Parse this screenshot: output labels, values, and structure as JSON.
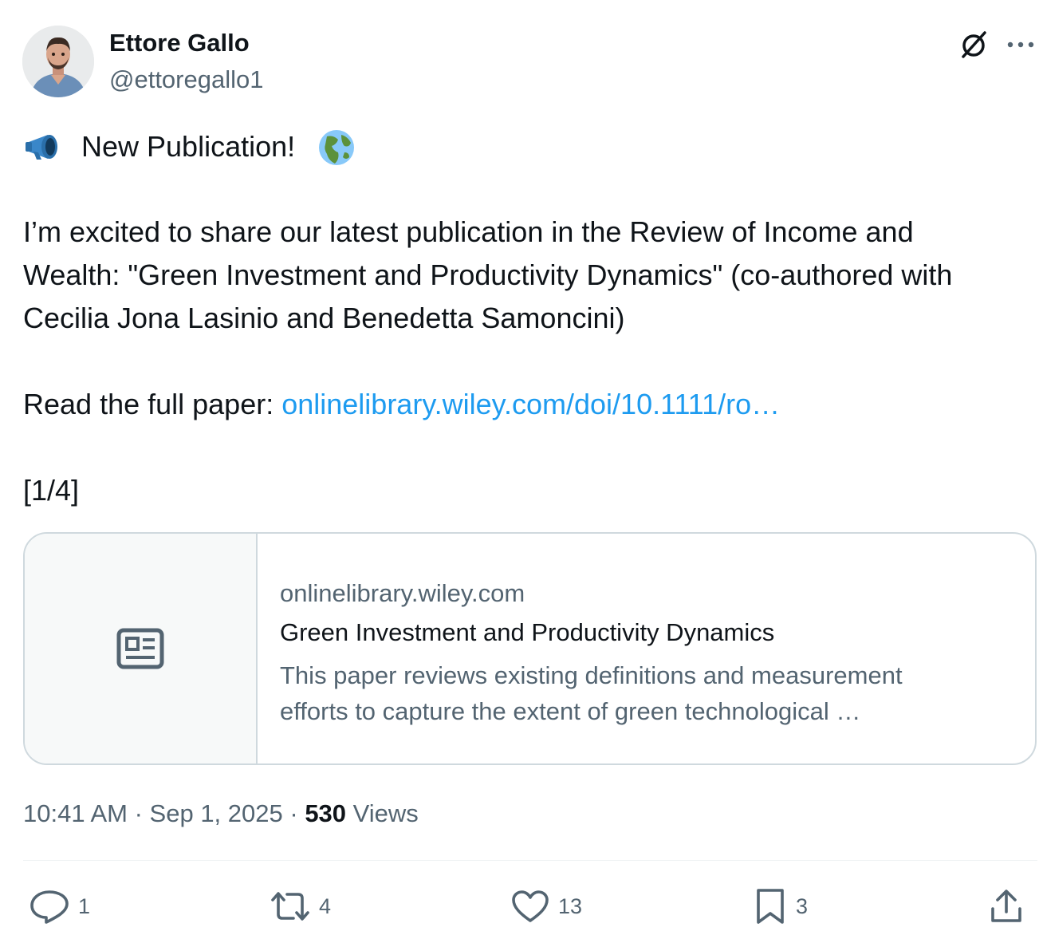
{
  "author": {
    "name": "Ettore Gallo",
    "handle": "@ettoregallo1"
  },
  "tweet": {
    "headline": "New Publication!",
    "body_lines": [
      "I’m excited to share our latest publication in the Review of Income and",
      "Wealth: \"Green Investment and Productivity Dynamics\" (co-authored with",
      "Cecilia Jona Lasinio and Benedetta Samoncini)"
    ],
    "read_prefix": "Read the full paper: ",
    "link_text": "onlinelibrary.wiley.com/doi/10.1111/ro…",
    "thread_counter": "[1/4]"
  },
  "card": {
    "domain": "onlinelibrary.wiley.com",
    "title": "Green Investment and Productivity Dynamics",
    "description_lines": [
      "This paper reviews existing definitions and measurement",
      "efforts to capture the extent of green technological …"
    ]
  },
  "meta": {
    "time": "10:41 AM",
    "separator": " · ",
    "date": "Sep 1, 2025",
    "views_count": "530",
    "views_label": " Views"
  },
  "actions": {
    "replies": "1",
    "reposts": "4",
    "likes": "13",
    "bookmarks": "3"
  },
  "icons": {
    "header": [
      "grok-icon",
      "more-icon"
    ],
    "actions": [
      "reply-icon",
      "retweet-icon",
      "like-icon",
      "bookmark-icon",
      "share-icon"
    ],
    "emoji": [
      "megaphone-icon",
      "globe-icon"
    ]
  },
  "colors": {
    "text": "#0f1419",
    "secondary": "#536471",
    "link": "#1d9bf0",
    "border": "#cfd9de"
  }
}
